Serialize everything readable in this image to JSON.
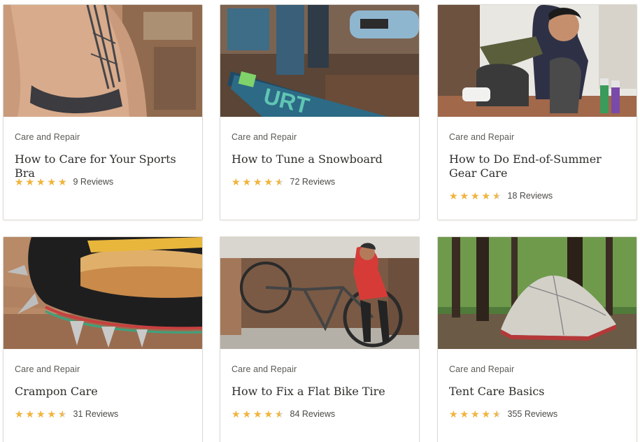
{
  "articles": [
    {
      "category": "Care and Repair",
      "title": "How to Care for Your Sports Bra",
      "rating": 5,
      "reviews_label": "9 Reviews",
      "image": "sports-bra-photo"
    },
    {
      "category": "Care and Repair",
      "title": "How to Tune a Snowboard",
      "rating": 4.5,
      "reviews_label": "72 Reviews",
      "image": "snowboard-photo"
    },
    {
      "category": "Care and Repair",
      "title": "How to Do End-of-Summer Gear Care",
      "rating": 4.5,
      "reviews_label": "18 Reviews",
      "image": "gear-care-photo"
    },
    {
      "category": "Care and Repair",
      "title": "Crampon Care",
      "rating": 4.5,
      "reviews_label": "31 Reviews",
      "image": "crampon-photo"
    },
    {
      "category": "Care and Repair",
      "title": "How to Fix a Flat Bike Tire",
      "rating": 4.5,
      "reviews_label": "84 Reviews",
      "image": "bike-tire-photo"
    },
    {
      "category": "Care and Repair",
      "title": "Tent Care Basics",
      "rating": 4.5,
      "reviews_label": "355 Reviews",
      "image": "tent-photo"
    }
  ],
  "colors": {
    "star_filled": "#f2b43b",
    "star_empty": "#d8cfb8",
    "card_border": "#dcdad3",
    "title_text": "#2e2e2b"
  }
}
